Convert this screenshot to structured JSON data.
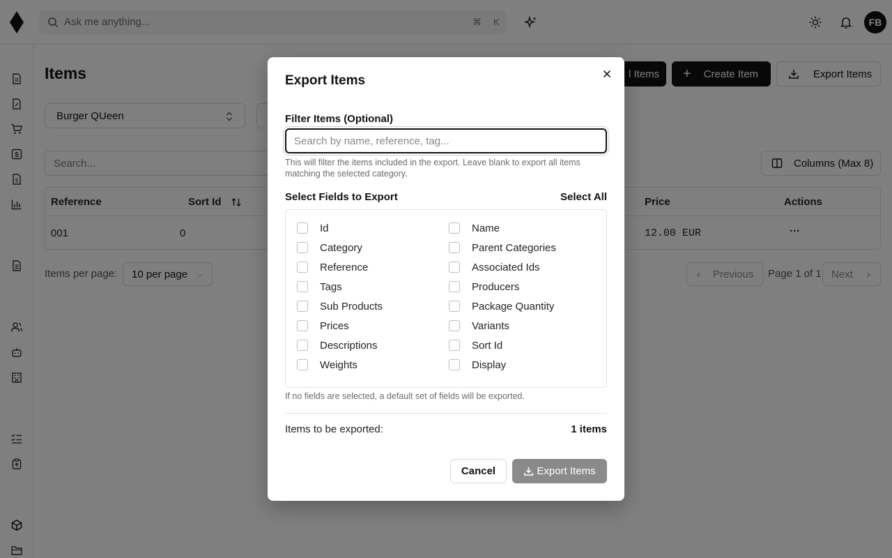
{
  "topbar": {
    "search_placeholder": "Ask me anything...",
    "shortcut_mod": "⌘",
    "shortcut_key": "K",
    "avatar_initials": "FB"
  },
  "sidebar": {
    "icons": [
      "document-icon",
      "document-edit-icon",
      "cart-icon",
      "dollar-icon",
      "invoice-icon",
      "bar-chart-icon",
      "list-document-icon",
      "users-icon",
      "bot-icon",
      "building-icon",
      "checklist-icon",
      "clipboard-icon",
      "box-icon",
      "folder-icon"
    ]
  },
  "page": {
    "title": "Items",
    "import_label": "l Items",
    "create_label": "Create Item",
    "export_label": "Export Items",
    "brand_select": "Burger QUeen",
    "table_search_placeholder": "Search...",
    "columns_label": "Columns (Max 8)",
    "table": {
      "headers": [
        "Reference",
        "Sort Id",
        "Price",
        "Actions"
      ],
      "row": {
        "reference": "001",
        "sort_id": "0",
        "price": "12.00 EUR",
        "actions": "···"
      }
    },
    "per_page_label": "Items per page:",
    "per_page_value": "10 per page",
    "prev_label": "Previous",
    "page_info": "Page 1 of 1",
    "next_label": "Next"
  },
  "modal": {
    "title": "Export Items",
    "filter_label": "Filter Items (Optional)",
    "filter_placeholder": "Search by name, reference, tag...",
    "filter_help": "This will filter the items included in the export. Leave blank to export all items matching the selected category.",
    "fields_label": "Select Fields to Export",
    "select_all": "Select All",
    "fields_left": [
      "Id",
      "Category",
      "Reference",
      "Tags",
      "Sub Products",
      "Prices",
      "Descriptions",
      "Weights"
    ],
    "fields_right": [
      "Name",
      "Parent Categories",
      "Associated Ids",
      "Producers",
      "Package Quantity",
      "Variants",
      "Sort Id",
      "Display"
    ],
    "fields_note": "If no fields are selected, a default set of fields will be exported.",
    "count_label": "Items to be exported:",
    "count_value": "1 items",
    "cancel_label": "Cancel",
    "export_label": "Export Items"
  },
  "colors": {
    "primary": "#111111",
    "disabled_button": "#8a8a8a",
    "overlay": "rgba(0,0,0,0.5)"
  }
}
